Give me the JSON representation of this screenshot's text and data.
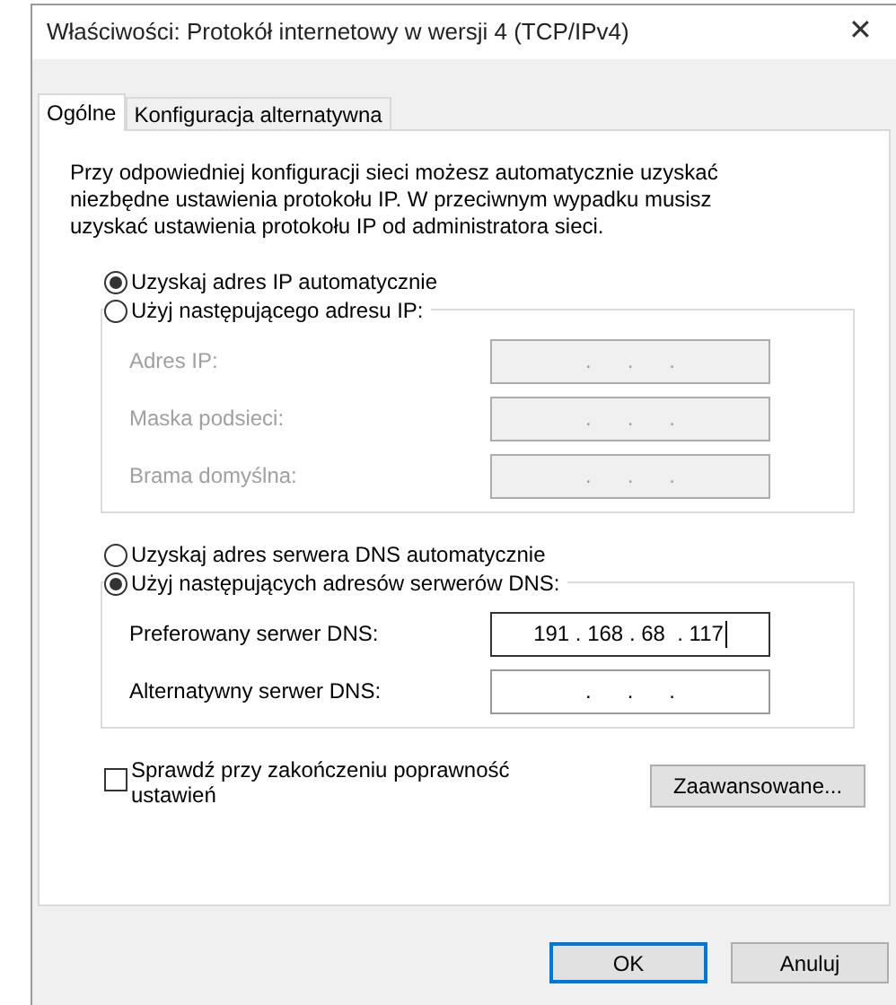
{
  "window": {
    "title": "Właściwości: Protokół internetowy w wersji 4 (TCP/IPv4)",
    "close": "✕"
  },
  "tabs": [
    {
      "label": "Ogólne",
      "selected": true
    },
    {
      "label": "Konfiguracja alternatywna",
      "selected": false
    }
  ],
  "description": "Przy odpowiedniej konfiguracji sieci możesz automatycznie uzyskać niezbędne ustawienia protokołu IP. W przeciwnym wypadku musisz uzyskać ustawienia protokołu IP od administratora sieci.",
  "ip": {
    "auto": {
      "label": "Uzyskaj adres IP automatycznie",
      "selected": true
    },
    "manual": {
      "label": "Użyj następującego adresu IP:",
      "selected": false
    },
    "fields": [
      {
        "label": "Adres IP:",
        "value": ".      .      .",
        "disabled": true
      },
      {
        "label": "Maska podsieci:",
        "value": ".      .      .",
        "disabled": true
      },
      {
        "label": "Brama domyślna:",
        "value": ".      .      .",
        "disabled": true
      }
    ]
  },
  "dns": {
    "auto": {
      "label": "Uzyskaj adres serwera DNS automatycznie",
      "selected": false
    },
    "manual": {
      "label": "Użyj następujących adresów serwerów DNS:",
      "selected": true
    },
    "fields": [
      {
        "label": "Preferowany serwer DNS:",
        "value": "191 . 168 . 68  . 117",
        "disabled": false,
        "focused": true
      },
      {
        "label": "Alternatywny serwer DNS:",
        "value": ".      .      .",
        "disabled": false,
        "focused": false
      }
    ]
  },
  "validate": {
    "label": "Sprawdź przy zakończeniu poprawność ustawień",
    "checked": false
  },
  "advanced_button": "Zaawansowane...",
  "buttons": [
    {
      "label": "OK",
      "default": true
    },
    {
      "label": "Anuluj",
      "default": false
    }
  ]
}
